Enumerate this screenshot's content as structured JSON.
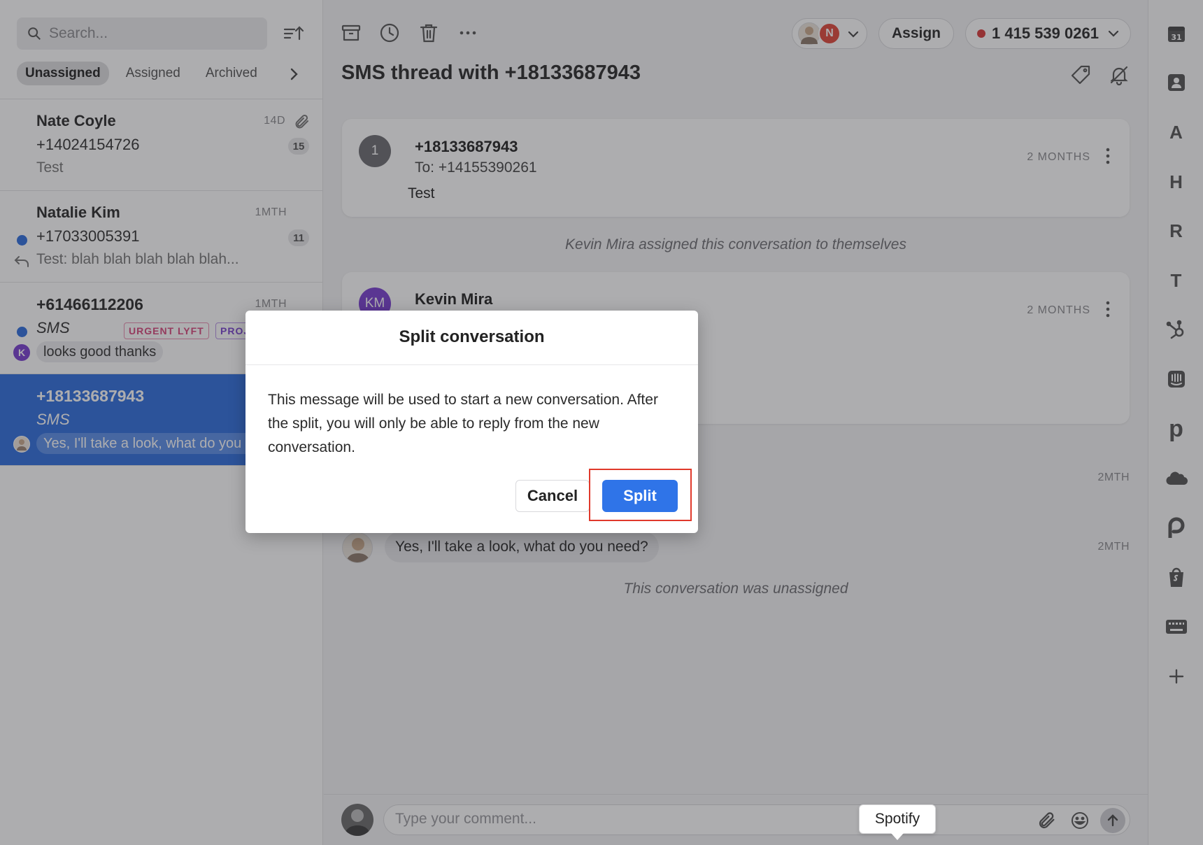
{
  "search": {
    "placeholder": "Search..."
  },
  "tabs": [
    "Unassigned",
    "Assigned",
    "Archived"
  ],
  "conversations": [
    {
      "name": "Nate Coyle",
      "number": "+14024154726",
      "preview": "Test",
      "time": "14D",
      "count": "15"
    },
    {
      "name": "Natalie Kim",
      "number": "+17033005391",
      "preview": "Test: blah blah blah blah blah...",
      "time": "1MTH",
      "count": "11"
    },
    {
      "name": "+61466112206",
      "channel": "SMS",
      "tags": [
        "URGENT LYFT",
        "PROJ"
      ],
      "preview": "looks good thanks",
      "avatar_letter": "K",
      "time": "1MTH"
    },
    {
      "name": "+18133687943",
      "channel": "SMS",
      "preview": "Yes, I'll take a look, what do you need?"
    }
  ],
  "header": {
    "title": "SMS thread with +18133687943",
    "avatar_letter": "N",
    "assign_label": "Assign",
    "phone_label": "1 415 539 0261"
  },
  "messages": [
    {
      "avatar_text": "1",
      "from": "+18133687943",
      "to": "To: +14155390261",
      "body": "Test",
      "ago": "2 MONTHS"
    },
    {
      "avatar_text": "KM",
      "from": "Kevin Mira",
      "ago": "2 MONTHS"
    }
  ],
  "system_notes": {
    "assigned": "Kevin Mira assigned this conversation to themselves",
    "unassigned": "This conversation was unassigned"
  },
  "thread": {
    "time_1": "2MTH",
    "reply": "Yes, I'll take a look, what do you need?",
    "time_2": "2MTH"
  },
  "composer": {
    "placeholder": "Type your comment..."
  },
  "tooltip": "Spotify",
  "rail": {
    "calendar_day": "31",
    "letters": [
      "A",
      "H",
      "R",
      "T"
    ],
    "p_letter": "p"
  },
  "modal": {
    "title": "Split conversation",
    "body": "This message will be used to start a new conversation. After the split, you will only be able to reply from the new conversation.",
    "cancel": "Cancel",
    "split": "Split"
  },
  "colors": {
    "accent": "#2f6fde",
    "split_button": "#2f74e8",
    "highlight": "#e0392b",
    "unread_dot": "#2f6fde",
    "status_dot": "#d93a3a"
  }
}
